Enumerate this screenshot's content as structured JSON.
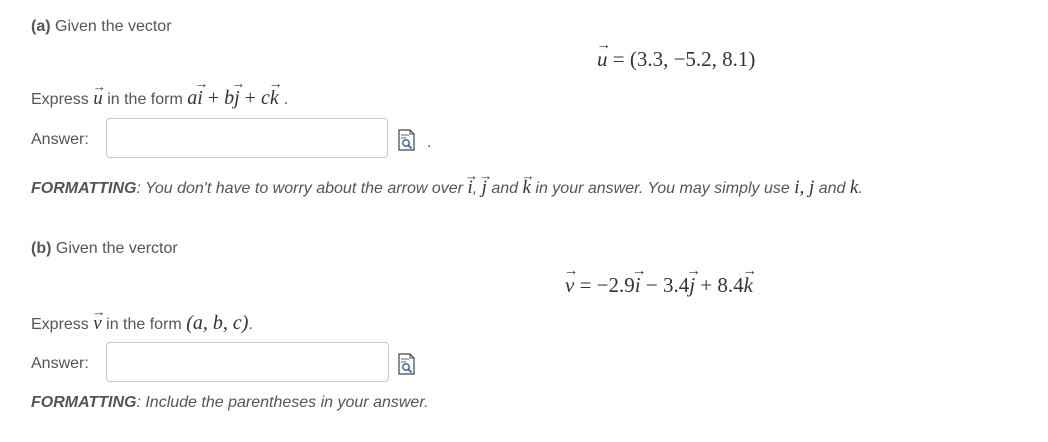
{
  "part_a": {
    "label": "(a)",
    "intro": "Given the vector",
    "equation": {
      "lhs": "u",
      "equals": "=",
      "value": "(3.3, −5.2, 8.1)"
    },
    "prompt_prefix": "Express",
    "prompt_vec": "u",
    "prompt_middle": "in the form",
    "form": {
      "a": "a",
      "i": "i",
      "plus1": "+",
      "b": "b",
      "j": "j",
      "plus2": "+",
      "c": "c",
      "k": "k",
      "end": "."
    },
    "answer_label": "Answer:",
    "answer_value": "",
    "after_icon": ".",
    "formatting_label": "FORMATTING",
    "formatting_text1": ": You don't have to worry about the arrow over",
    "formatting_i": "i",
    "formatting_comma": ",",
    "formatting_j": "j",
    "formatting_and": "and",
    "formatting_k": "k",
    "formatting_text2": "in your answer. You may simply use",
    "formatting_plain": "i, j",
    "formatting_and2": "and",
    "formatting_plain_k": "k",
    "formatting_end": "."
  },
  "part_b": {
    "label": "(b)",
    "intro": "Given the verctor",
    "equation": {
      "lhs": "v",
      "equals": "=",
      "t1": "−2.9",
      "i": "i",
      "minus": "−",
      "t2": "3.4",
      "j": "j",
      "plus": "+",
      "t3": "8.4",
      "k": "k"
    },
    "prompt_prefix": "Express",
    "prompt_vec": "v",
    "prompt_middle": "in the form",
    "form": "(a, b, c)",
    "form_end": ".",
    "answer_label": "Answer:",
    "answer_value": "",
    "formatting_label": "FORMATTING",
    "formatting_text": ": Include the parentheses in your answer."
  },
  "icons": {
    "preview": "formula-preview-icon"
  }
}
